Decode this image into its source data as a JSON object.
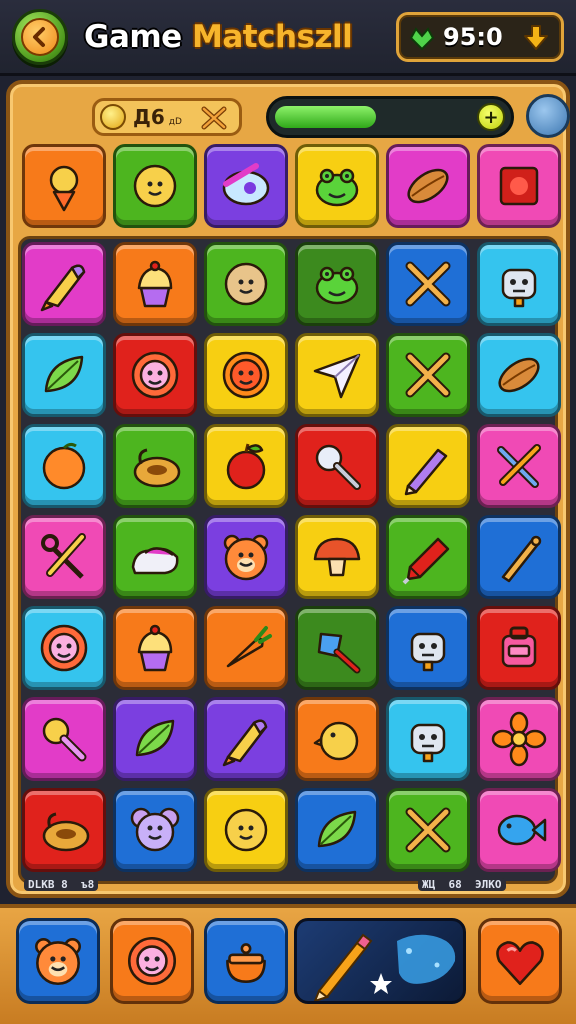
{
  "header": {
    "title_part1": "Game ",
    "title_part2": "Matchszll",
    "score": "95:0"
  },
  "topbar": {
    "coins": "Д6",
    "coins_suffix": "дD",
    "progress_fraction": 0.48
  },
  "labels": {
    "bottom_left": "DLKB 8",
    "bottom_left_b": "ъ8",
    "bottom_right_a": "ЖЦ",
    "bottom_right_b": "68",
    "bottom_right_c": "ЭЛКО"
  },
  "colors": {
    "magenta": "#e23cc8",
    "orange": "#f77a1a",
    "green": "#4db51f",
    "darkgreen": "#3c8a1e",
    "blue": "#1f6fd6",
    "cyan": "#35c4ee",
    "red": "#e0221c",
    "yellow": "#f7cf12",
    "purple": "#7b3fe0",
    "pink": "#f04ab5",
    "mint": "#7fd94a"
  },
  "top_row": [
    {
      "color": "orange",
      "icon": "sun-rocket-icon"
    },
    {
      "color": "green",
      "icon": "smiley-icon"
    },
    {
      "color": "purple",
      "icon": "eye-shell-icon"
    },
    {
      "color": "yellow",
      "icon": "frog-icon"
    },
    {
      "color": "magenta",
      "icon": "bean-icon"
    },
    {
      "color": "pink",
      "icon": "red-box-icon"
    }
  ],
  "grid": [
    [
      {
        "color": "magenta",
        "icon": "rocket-icon"
      },
      {
        "color": "orange",
        "icon": "cupcake-icon"
      },
      {
        "color": "green",
        "icon": "cookie-icon"
      },
      {
        "color": "darkgreen",
        "icon": "frog-icon"
      },
      {
        "color": "blue",
        "icon": "crossed-sticks-icon"
      },
      {
        "color": "cyan",
        "icon": "robot-icon"
      }
    ],
    [
      {
        "color": "cyan",
        "icon": "leaf-icon"
      },
      {
        "color": "red",
        "icon": "flower-face-icon"
      },
      {
        "color": "yellow",
        "icon": "sun-face-icon"
      },
      {
        "color": "yellow",
        "icon": "paper-plane-icon"
      },
      {
        "color": "green",
        "icon": "crossed-sticks-icon"
      },
      {
        "color": "cyan",
        "icon": "bean-icon"
      }
    ],
    [
      {
        "color": "cyan",
        "icon": "orange-icon"
      },
      {
        "color": "green",
        "icon": "lock-icon"
      },
      {
        "color": "yellow",
        "icon": "apple-icon"
      },
      {
        "color": "red",
        "icon": "magnifier-icon"
      },
      {
        "color": "yellow",
        "icon": "pencil-icon"
      },
      {
        "color": "pink",
        "icon": "tools-icon"
      }
    ],
    [
      {
        "color": "pink",
        "icon": "scissors-icon"
      },
      {
        "color": "green",
        "icon": "shoe-icon"
      },
      {
        "color": "purple",
        "icon": "bear-icon"
      },
      {
        "color": "yellow",
        "icon": "mushroom-icon"
      },
      {
        "color": "green",
        "icon": "drill-icon"
      },
      {
        "color": "blue",
        "icon": "bat-icon"
      }
    ],
    [
      {
        "color": "cyan",
        "icon": "flower-face-icon"
      },
      {
        "color": "orange",
        "icon": "cupcake-icon"
      },
      {
        "color": "orange",
        "icon": "carrot-icon"
      },
      {
        "color": "darkgreen",
        "icon": "shovel-icon"
      },
      {
        "color": "blue",
        "icon": "robot-icon"
      },
      {
        "color": "red",
        "icon": "backpack-icon"
      }
    ],
    [
      {
        "color": "magenta",
        "icon": "rattle-icon"
      },
      {
        "color": "purple",
        "icon": "leaf-icon"
      },
      {
        "color": "purple",
        "icon": "rocket-icon"
      },
      {
        "color": "orange",
        "icon": "chick-icon"
      },
      {
        "color": "cyan",
        "icon": "robot-icon"
      },
      {
        "color": "pink",
        "icon": "flower-icon"
      }
    ],
    [
      {
        "color": "red",
        "icon": "lock-icon"
      },
      {
        "color": "blue",
        "icon": "mouse-icon"
      },
      {
        "color": "yellow",
        "icon": "smiley-icon"
      },
      {
        "color": "blue",
        "icon": "leaf-icon"
      },
      {
        "color": "green",
        "icon": "crossed-sticks-icon"
      },
      {
        "color": "pink",
        "icon": "fish-icon"
      }
    ]
  ],
  "bottom_bar": [
    {
      "color": "blue",
      "icon": "bear-icon"
    },
    {
      "color": "orange",
      "icon": "flower-face-icon"
    },
    {
      "color": "blue",
      "icon": "pot-icon"
    },
    {
      "color": "orange",
      "icon": "heart-icon"
    }
  ]
}
